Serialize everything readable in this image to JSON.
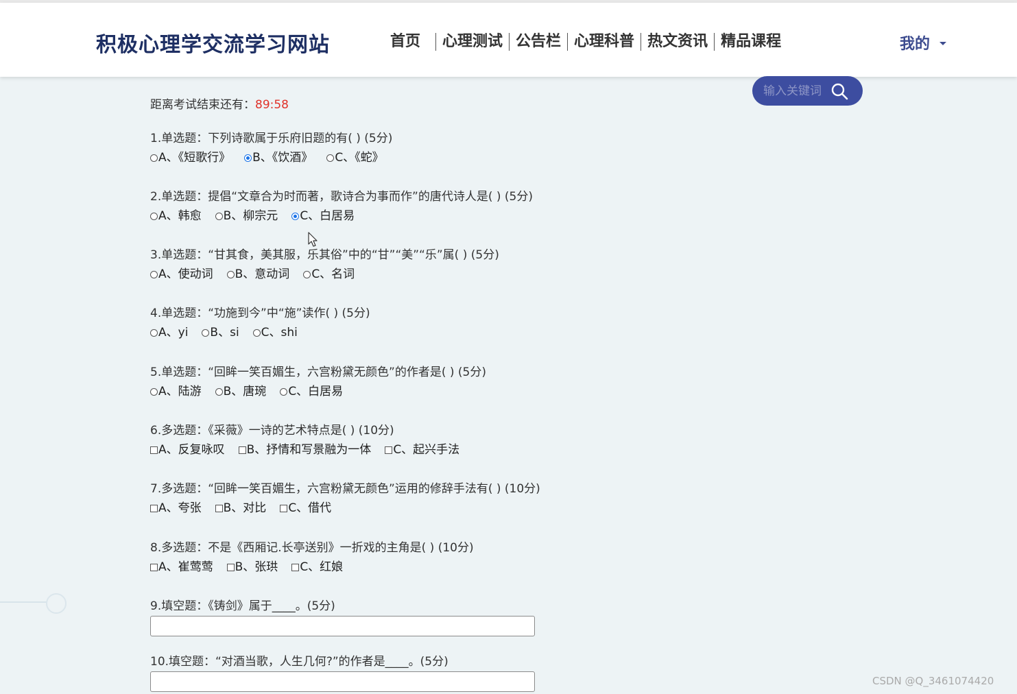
{
  "site": {
    "logo": "积极心理学交流学习网站"
  },
  "nav": {
    "items": [
      {
        "label": "首页"
      },
      {
        "label": "心理测试"
      },
      {
        "label": "公告栏"
      },
      {
        "label": "心理科普"
      },
      {
        "label": "热文资讯"
      },
      {
        "label": "精品课程"
      }
    ],
    "user_menu": "我的"
  },
  "search": {
    "placeholder": "输入关键词"
  },
  "exam": {
    "timer_label": "距离考试结束还有：",
    "timer_value": "89:58",
    "questions": [
      {
        "title": "1.单选题：下列诗歌属于乐府旧题的有( ) (5分)",
        "type": "radio",
        "options": [
          "A、《短歌行》",
          "B、《饮酒》",
          "C、《蛇》"
        ],
        "selected": 1
      },
      {
        "title": "2.单选题：提倡“文章合为时而著，歌诗合为事而作”的唐代诗人是( ) (5分)",
        "type": "radio",
        "options": [
          "A、韩愈",
          "B、柳宗元",
          "C、白居易"
        ],
        "selected": 2
      },
      {
        "title": "3.单选题：“甘其食，美其服，乐其俗”中的“甘”“美”“乐”属( ) (5分)",
        "type": "radio",
        "options": [
          "A、使动词",
          "B、意动词",
          "C、名词"
        ],
        "selected": -1
      },
      {
        "title": "4.单选题：“功施到今”中“施”读作( ) (5分)",
        "type": "radio",
        "options": [
          "A、yi",
          "B、si",
          "C、shi"
        ],
        "selected": -1
      },
      {
        "title": "5.单选题：“回眸一笑百媚生，六宫粉黛无颜色”的作者是( ) (5分)",
        "type": "radio",
        "options": [
          "A、陆游",
          "B、唐琬",
          "C、白居易"
        ],
        "selected": -1
      },
      {
        "title": "6.多选题：《采薇》一诗的艺术特点是( ) (10分)",
        "type": "checkbox",
        "options": [
          "A、反复咏叹",
          "B、抒情和写景融为一体",
          "C、起兴手法"
        ],
        "selected": -1
      },
      {
        "title": "7.多选题：“回眸一笑百媚生，六宫粉黛无颜色”运用的修辞手法有( ) (10分)",
        "type": "checkbox",
        "options": [
          "A、夸张",
          "B、对比",
          "C、借代"
        ],
        "selected": -1
      },
      {
        "title": "8.多选题：不是《西厢记.长亭送别》一折戏的主角是( ) (10分)",
        "type": "checkbox",
        "options": [
          "A、崔莺莺",
          "B、张珙",
          "C、红娘"
        ],
        "selected": -1
      },
      {
        "title": "9.填空题：《铸剑》属于____。(5分)",
        "type": "text",
        "value": ""
      },
      {
        "title": "10.填空题：“对酒当歌，人生几何?”的作者是____。(5分)",
        "type": "text",
        "value": ""
      }
    ]
  },
  "watermark": "CSDN @Q_3461074420",
  "colors": {
    "accent": "#3d4da0",
    "timer": "#e0322a",
    "logo": "#1e2f63",
    "background": "#edf3f5"
  }
}
